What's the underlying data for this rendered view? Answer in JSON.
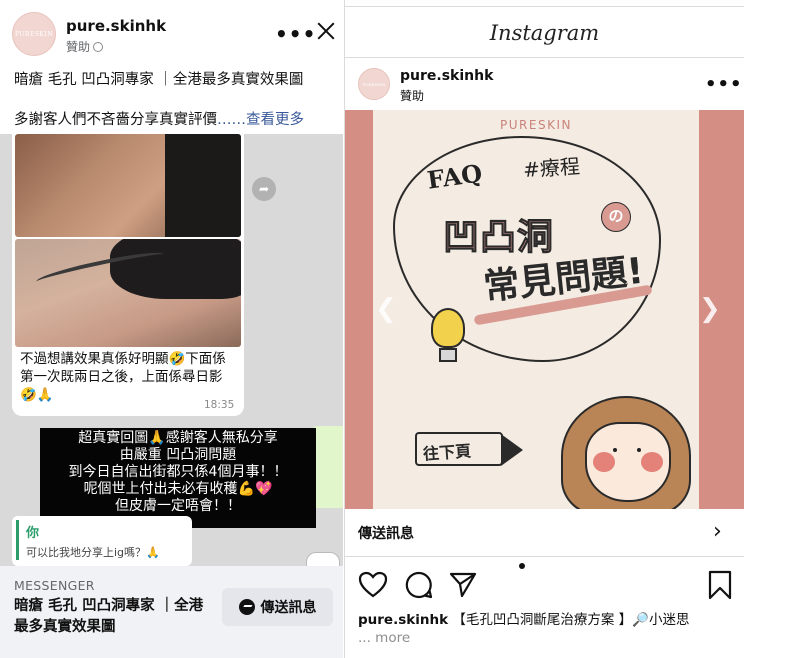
{
  "facebook": {
    "page_name": "pure.skinhk",
    "sponsored": "贊助",
    "avatar_text": "PURESKIN",
    "text_line1": "暗瘡 毛孔 凹凸洞專家 ｜全港最多真實效果圖",
    "text_line2": "多謝客人們不吝嗇分享真實評價",
    "see_more": "……查看更多",
    "chat": {
      "message": "不過想講效果真係好明顯🤣下面係第一次既兩日之後，上面係尋日影🤣🙏",
      "time": "18:35",
      "overlay_lines": [
        "超真實回圖🙏感謝客人無私分享",
        "由嚴重 凹凸洞問題",
        "到今日自信出街都只係4個月事！！",
        "呢個世上付出未必有收穫💪💖",
        "但皮膚一定唔會！！"
      ],
      "reply_name": "你",
      "reply_text": "可以比我地分享上ig嗎？🙏"
    },
    "footer": {
      "label": "MESSENGER",
      "title": "暗瘡 毛孔 凹凸洞專家 ｜全港最多真實效果圖",
      "button": "傳送訊息"
    }
  },
  "instagram": {
    "logo": "Instagram",
    "username": "pure.skinhk",
    "sponsored": "贊助",
    "avatar_text": "PURESKIN",
    "image": {
      "brand": "PURESKIN",
      "faq": "FAQ",
      "tag": "#療程",
      "title_line1": "凹凸洞",
      "title_no": "の",
      "title_line2": "常見問題!",
      "next_page": "往下頁"
    },
    "cta_label": "傳送訊息",
    "caption_user": "pure.skinhk",
    "caption_text": "【毛孔凹凸洞斷尾治療方案 】🔎小迷思",
    "more": "... more"
  }
}
